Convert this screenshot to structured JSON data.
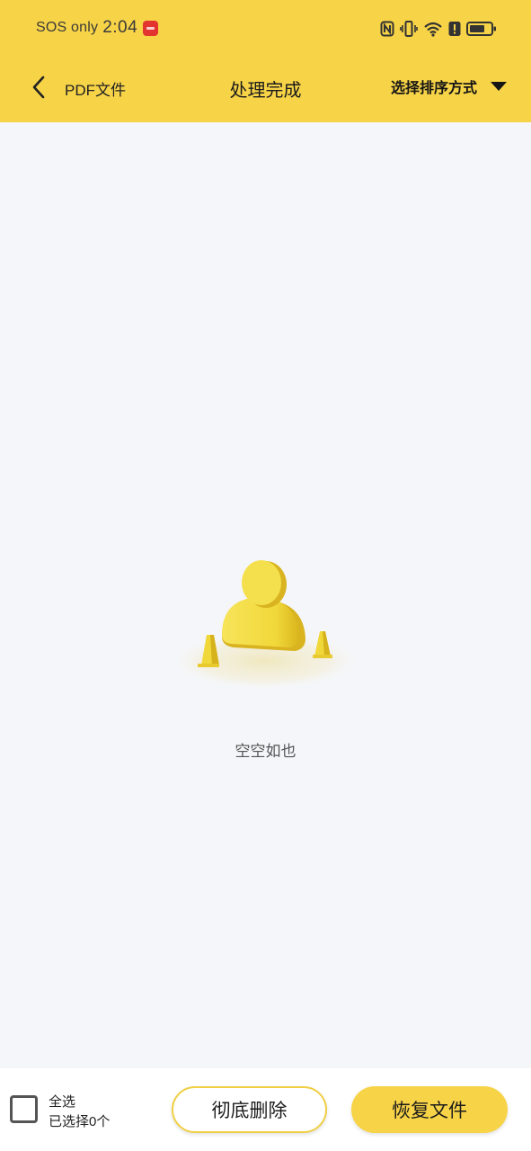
{
  "status_bar": {
    "carrier": "SOS only",
    "time": "2:04",
    "icons": [
      "app-notification-icon",
      "nfc-icon",
      "vibrate-icon",
      "wifi-icon",
      "alert-icon",
      "battery-icon"
    ]
  },
  "header": {
    "back_label": "PDF文件",
    "title": "处理完成",
    "sort_label": "选择排序方式"
  },
  "empty_state": {
    "text": "空空如也"
  },
  "bottom_bar": {
    "select_all_label": "全选",
    "selected_count": "已选择0个",
    "delete_button": "彻底删除",
    "restore_button": "恢复文件"
  },
  "colors": {
    "accent": "#f7d347",
    "background": "#f5f6f9"
  }
}
